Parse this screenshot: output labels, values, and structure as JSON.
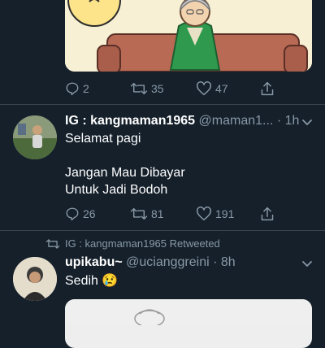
{
  "tweet1": {
    "actions": {
      "replies": "2",
      "retweets": "35",
      "likes": "47"
    }
  },
  "tweet2": {
    "display_name": "IG : kangmaman1965",
    "handle": "@maman1...",
    "dot": "·",
    "time": "1h",
    "text_line1": "Selamat pagi",
    "text_line2": "Jangan Mau Dibayar",
    "text_line3": "Untuk Jadi Bodoh",
    "actions": {
      "replies": "26",
      "retweets": "81",
      "likes": "191"
    }
  },
  "tweet3": {
    "retweeted_by": "IG : kangmaman1965 Retweeted",
    "display_name": "upikabu~",
    "handle": "@ucianggreini",
    "dot": "·",
    "time": "8h",
    "text": "Sedih 😢"
  },
  "colors": {
    "background": "#15202b",
    "muted": "#8899a6",
    "separator": "#38444d",
    "accent": "#1da1f2"
  },
  "icons": [
    "reply-icon",
    "retweet-icon",
    "like-icon",
    "share-icon",
    "chevron-down-icon"
  ]
}
